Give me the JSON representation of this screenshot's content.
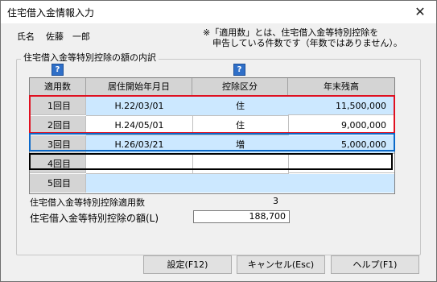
{
  "window": {
    "title": "住宅借入金情報入力"
  },
  "person": {
    "label": "氏名",
    "name": "佐藤　一郎"
  },
  "note": {
    "line1": "※「適用数」とは、住宅借入金等特別控除を",
    "line2": "申告している件数です（年数ではありません）。"
  },
  "group": {
    "title": "住宅借入金等特別控除の額の内訳"
  },
  "table": {
    "headers": [
      "適用数",
      "居住開始年月日",
      "控除区分",
      "年末残高"
    ],
    "rows": [
      {
        "label": "1回目",
        "date": "H.22/03/01",
        "kubun": "住",
        "balance": "11,500,000"
      },
      {
        "label": "2回目",
        "date": "H.24/05/01",
        "kubun": "住",
        "balance": "9,000,000"
      },
      {
        "label": "3回目",
        "date": "H.26/03/21",
        "kubun": "増",
        "balance": "5,000,000"
      },
      {
        "label": "4回目",
        "date": "",
        "kubun": "",
        "balance": ""
      },
      {
        "label": "5回目",
        "date": "",
        "kubun": "",
        "balance": ""
      }
    ]
  },
  "summary": {
    "count_label": "住宅借入金等特別控除適用数",
    "count_value": "3",
    "amount_label": "住宅借入金等特別控除の額(L)",
    "amount_value": "188,700"
  },
  "buttons": {
    "ok": "設定(F12)",
    "cancel": "キャンセル(Esc)",
    "help": "ヘルプ(F1)"
  },
  "icons": {
    "close": "close-icon",
    "help": "help-question-icon"
  },
  "colors": {
    "selected_row": "#cce8ff",
    "red_highlight": "#e01020",
    "blue_highlight": "#0a68c8"
  }
}
